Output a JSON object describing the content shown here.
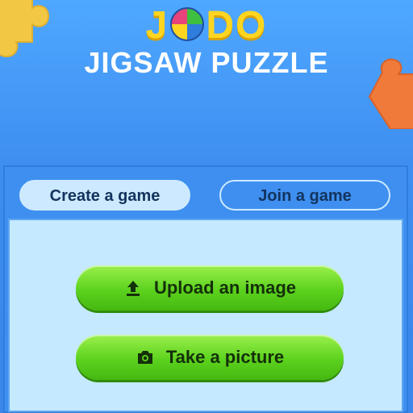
{
  "logo": {
    "letter_j": "J",
    "letters_do": "DO"
  },
  "title": "JIGSAW PUZZLE",
  "tabs": [
    {
      "label": "Create a game",
      "active": true
    },
    {
      "label": "Join a game",
      "active": false
    }
  ],
  "actions": {
    "upload_label": "Upload an image",
    "upload_icon": "upload-icon",
    "picture_label": "Take a picture",
    "picture_icon": "camera-icon"
  },
  "colors": {
    "background": "#3d8ef0",
    "logo_yellow": "#ffd51f",
    "button_green": "#5cd21e",
    "tab_active": "#cde9ff",
    "panel_content": "#c5e9ff",
    "text_dark": "#13335e"
  }
}
